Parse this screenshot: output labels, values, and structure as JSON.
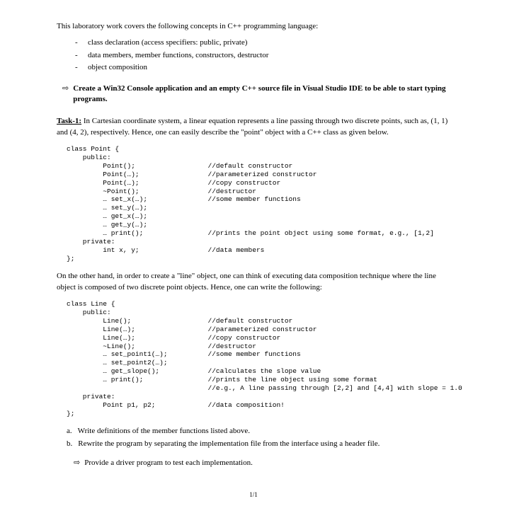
{
  "intro": "This laboratory work covers the following concepts in C++ programming language:",
  "concepts": [
    "class declaration (access specifiers: public, private)",
    "data members, member functions, constructors, destructor",
    "object composition"
  ],
  "instructionArrow": "⇨",
  "instruction": "Create a Win32 Console application and an empty C++ source file in Visual Studio IDE to be able to start typing programs.",
  "task1": {
    "label": "Task-1:",
    "text": " In Cartesian coordinate system, a linear equation represents a line passing through two discrete points, such as, (1, 1) and (4, 2), respectively. Hence, one can easily describe the \"point\" object with a C++ class as given below."
  },
  "pointCode": "class Point {\n    public:\n         Point();                  //default constructor\n         Point(…);                 //parameterized constructor\n         Point(…);                 //copy constructor\n         ~Point();                 //destructor\n         … set_x(…);               //some member functions\n         … set_y(…);\n         … get_x(…);\n         … get_y(…);\n         … print();                //prints the point object using some format, e.g., [1,2]\n    private:\n         int x, y;                 //data members\n};",
  "mid": "On the other hand, in order to create a \"line\" object, one can think of executing data composition technique where the line object is composed of two discrete point objects. Hence, one can write the following:",
  "lineCode": "class Line {\n    public:\n         Line();                   //default constructor\n         Line(…);                  //parameterized constructor\n         Line(…);                  //copy constructor\n         ~Line();                  //destructor\n         … set_point1(…);          //some member functions\n         … set_point2(…);\n         … get_slope();            //calculates the slope value\n         … print();                //prints the line object using some format\n                                   //e.g., A line passing through [2,2] and [4,4] with slope = 1.0\n    private:\n         Point p1, p2;             //data composition!\n};",
  "questions": [
    {
      "n": "a.",
      "t": "Write definitions of the member functions listed above."
    },
    {
      "n": "b.",
      "t": "Rewrite the program by separating the implementation file from the interface using a header file."
    }
  ],
  "provideArrow": "⇨",
  "provide": "Provide a driver program to test each implementation.",
  "pager": "1/1"
}
